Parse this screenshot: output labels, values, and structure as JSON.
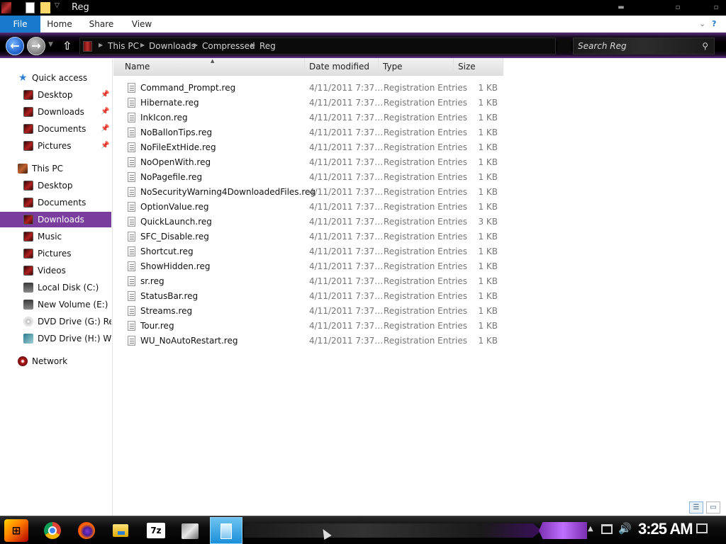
{
  "window": {
    "title": "Reg"
  },
  "ribbon": {
    "tabs": [
      "File",
      "Home",
      "Share",
      "View"
    ]
  },
  "address": {
    "crumbs": [
      "This PC",
      "Downloads",
      "Compressed",
      "Reg"
    ],
    "search_placeholder": "Search Reg"
  },
  "sidebar": {
    "quick_access": "Quick access",
    "quick_items": [
      "Desktop",
      "Downloads",
      "Documents",
      "Pictures"
    ],
    "this_pc": "This PC",
    "pc_items": [
      "Desktop",
      "Documents",
      "Downloads",
      "Music",
      "Pictures",
      "Videos",
      "Local Disk (C:)",
      "New Volume (E:)",
      "DVD Drive (G:) Revi",
      "DVD Drive (H:) Win"
    ],
    "network": "Network"
  },
  "columns": {
    "name": "Name",
    "date": "Date modified",
    "type": "Type",
    "size": "Size"
  },
  "files": [
    {
      "name": "Command_Prompt.reg",
      "date": "4/11/2011 7:37…",
      "type": "Registration Entries",
      "size": "1 KB"
    },
    {
      "name": "Hibernate.reg",
      "date": "4/11/2011 7:37…",
      "type": "Registration Entries",
      "size": "1 KB"
    },
    {
      "name": "InkIcon.reg",
      "date": "4/11/2011 7:37…",
      "type": "Registration Entries",
      "size": "1 KB"
    },
    {
      "name": "NoBallonTips.reg",
      "date": "4/11/2011 7:37…",
      "type": "Registration Entries",
      "size": "1 KB"
    },
    {
      "name": "NoFileExtHide.reg",
      "date": "4/11/2011 7:37…",
      "type": "Registration Entries",
      "size": "1 KB"
    },
    {
      "name": "NoOpenWith.reg",
      "date": "4/11/2011 7:37…",
      "type": "Registration Entries",
      "size": "1 KB"
    },
    {
      "name": "NoPagefile.reg",
      "date": "4/11/2011 7:37…",
      "type": "Registration Entries",
      "size": "1 KB"
    },
    {
      "name": "NoSecurityWarning4DownloadedFiles.reg",
      "date": "4/11/2011 7:37…",
      "type": "Registration Entries",
      "size": "1 KB"
    },
    {
      "name": "OptionValue.reg",
      "date": "4/11/2011 7:37…",
      "type": "Registration Entries",
      "size": "1 KB"
    },
    {
      "name": "QuickLaunch.reg",
      "date": "4/11/2011 7:37…",
      "type": "Registration Entries",
      "size": "3 KB"
    },
    {
      "name": "SFC_Disable.reg",
      "date": "4/11/2011 7:37…",
      "type": "Registration Entries",
      "size": "1 KB"
    },
    {
      "name": "Shortcut.reg",
      "date": "4/11/2011 7:37…",
      "type": "Registration Entries",
      "size": "1 KB"
    },
    {
      "name": "ShowHidden.reg",
      "date": "4/11/2011 7:37…",
      "type": "Registration Entries",
      "size": "1 KB"
    },
    {
      "name": "sr.reg",
      "date": "4/11/2011 7:37…",
      "type": "Registration Entries",
      "size": "1 KB"
    },
    {
      "name": "StatusBar.reg",
      "date": "4/11/2011 7:37…",
      "type": "Registration Entries",
      "size": "1 KB"
    },
    {
      "name": "Streams.reg",
      "date": "4/11/2011 7:37…",
      "type": "Registration Entries",
      "size": "1 KB"
    },
    {
      "name": "Tour.reg",
      "date": "4/11/2011 7:37…",
      "type": "Registration Entries",
      "size": "1 KB"
    },
    {
      "name": "WU_NoAutoRestart.reg",
      "date": "4/11/2011 7:37…",
      "type": "Registration Entries",
      "size": "1 KB"
    }
  ],
  "taskbar": {
    "apps": [
      "chrome",
      "firefox",
      "file-explorer",
      "7z",
      "registry-editor",
      "active-window"
    ],
    "seven_zip_label": "7z",
    "clock": "3:25 AM"
  },
  "colors": {
    "accent": "#7a3d9e",
    "file_tab": "#1979ca",
    "clock": "#ffffff"
  }
}
